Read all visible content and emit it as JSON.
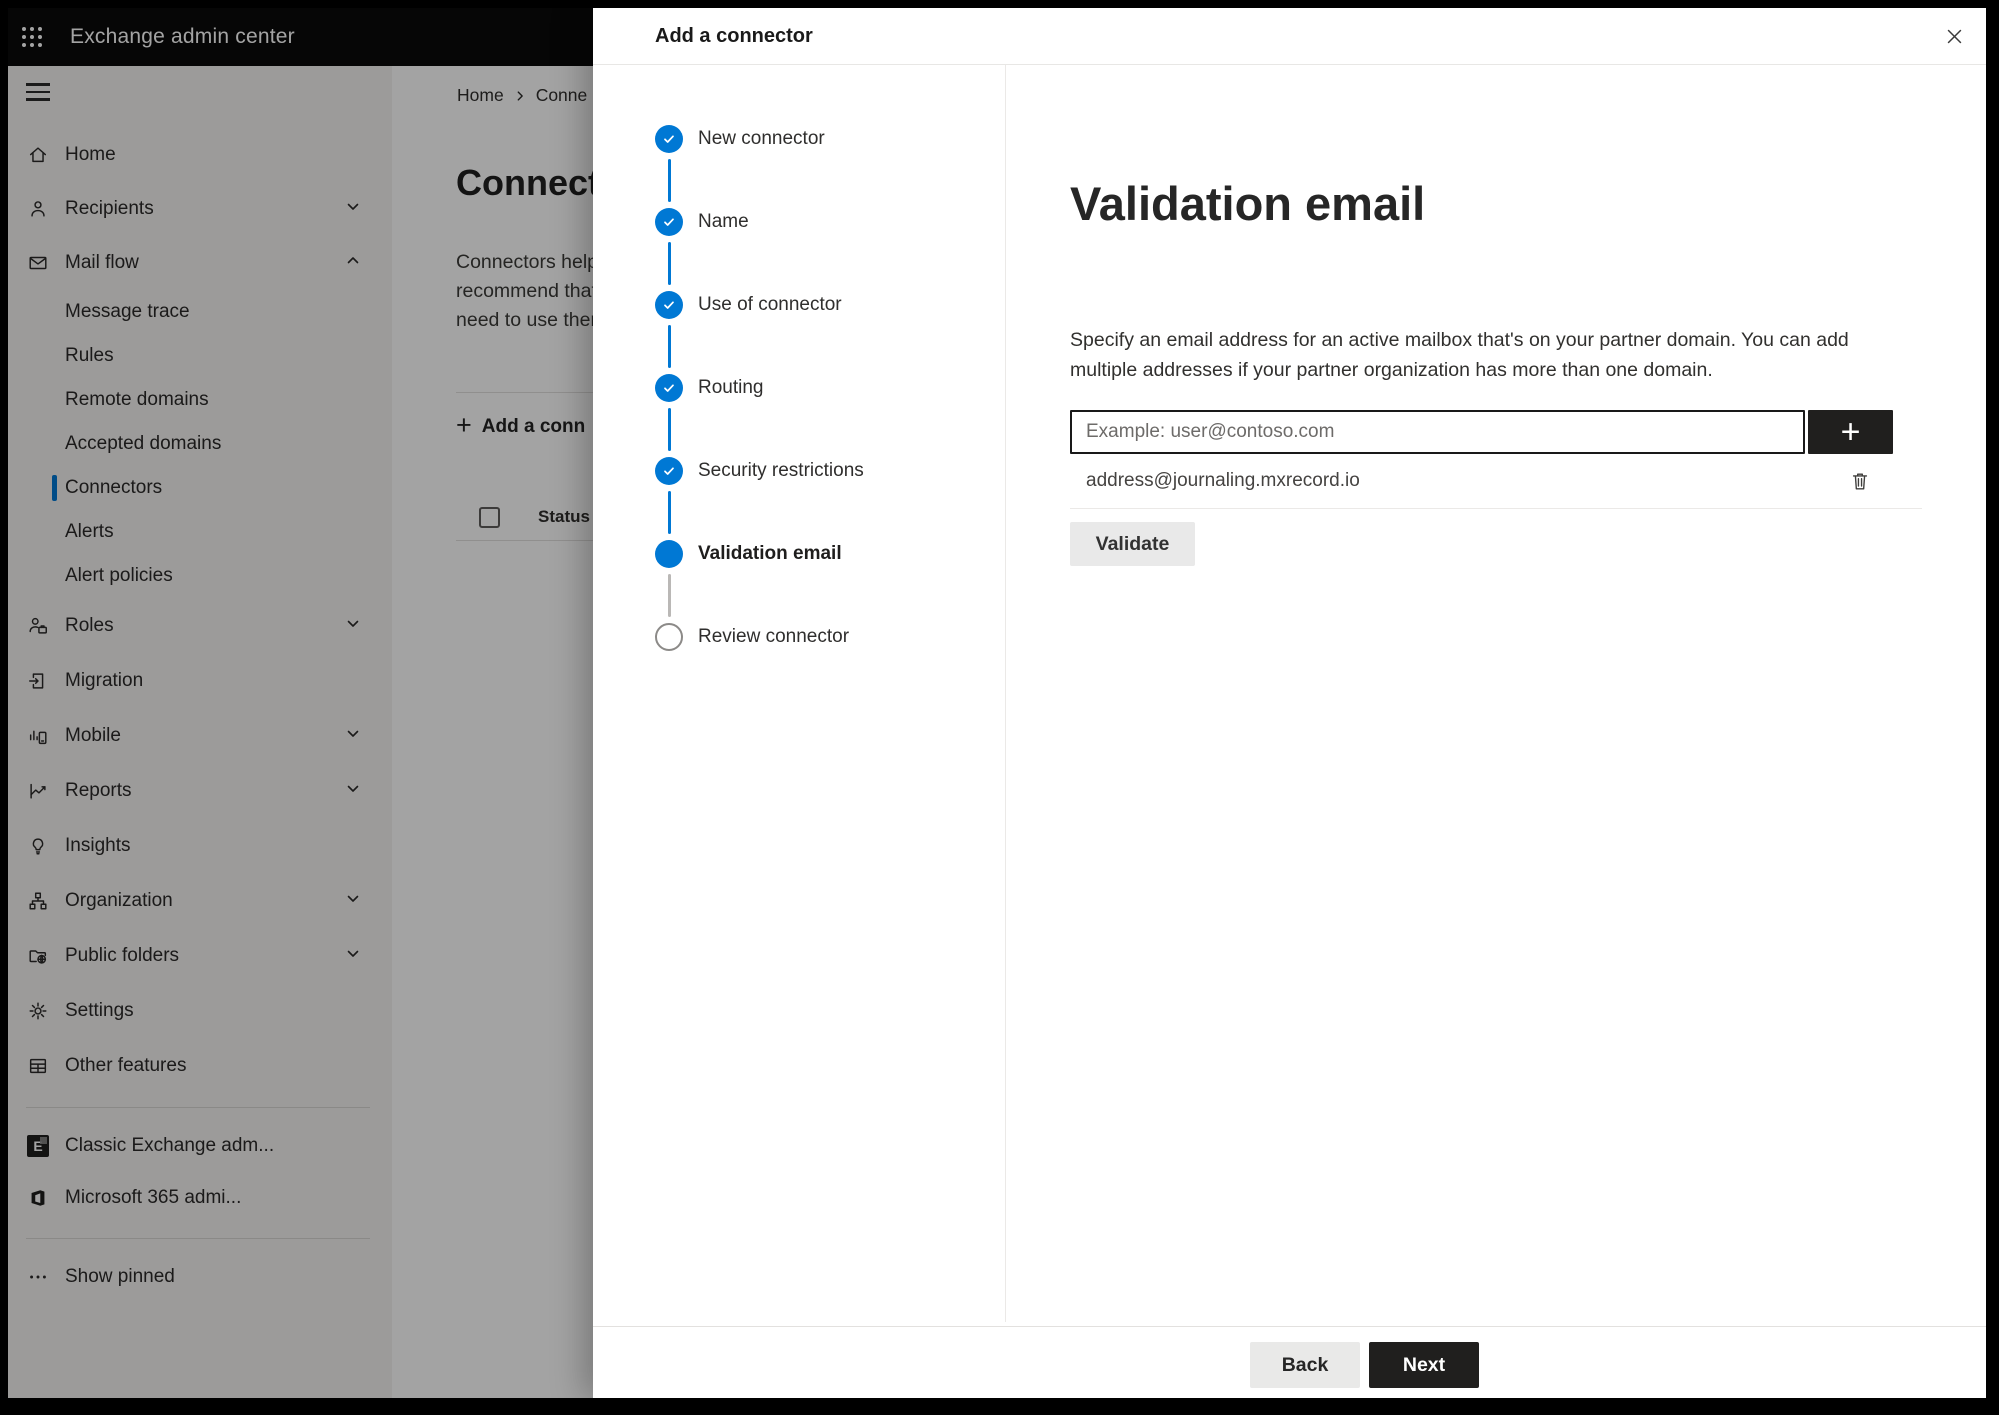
{
  "topbar": {
    "title": "Exchange admin center"
  },
  "sidebar": {
    "items": [
      {
        "label": "Home",
        "icon": "home-icon",
        "level": 1
      },
      {
        "label": "Recipients",
        "icon": "person-icon",
        "level": 1,
        "chevron": "down"
      },
      {
        "label": "Mail flow",
        "icon": "mail-icon",
        "level": 1,
        "chevron": "up",
        "expanded": true
      },
      {
        "label": "Message trace",
        "level": 2
      },
      {
        "label": "Rules",
        "level": 2
      },
      {
        "label": "Remote domains",
        "level": 2
      },
      {
        "label": "Accepted domains",
        "level": 2
      },
      {
        "label": "Connectors",
        "level": 2,
        "selected": true
      },
      {
        "label": "Alerts",
        "level": 2
      },
      {
        "label": "Alert policies",
        "level": 2
      },
      {
        "label": "Roles",
        "icon": "roles-icon",
        "level": 1,
        "chevron": "down"
      },
      {
        "label": "Migration",
        "icon": "migration-icon",
        "level": 1
      },
      {
        "label": "Mobile",
        "icon": "mobile-icon",
        "level": 1,
        "chevron": "down"
      },
      {
        "label": "Reports",
        "icon": "reports-icon",
        "level": 1,
        "chevron": "down"
      },
      {
        "label": "Insights",
        "icon": "lightbulb-icon",
        "level": 1
      },
      {
        "label": "Organization",
        "icon": "org-icon",
        "level": 1,
        "chevron": "down"
      },
      {
        "label": "Public folders",
        "icon": "folder-globe-icon",
        "level": 1,
        "chevron": "down"
      },
      {
        "label": "Settings",
        "icon": "gear-icon",
        "level": 1
      },
      {
        "label": "Other features",
        "icon": "grid-icon",
        "level": 1
      }
    ],
    "links": [
      {
        "label": "Classic Exchange adm...",
        "icon": "exchange-logo-icon"
      },
      {
        "label": "Microsoft 365 admi...",
        "icon": "office-logo-icon"
      }
    ],
    "show_pinned_label": "Show pinned"
  },
  "page": {
    "breadcrumb": {
      "home": "Home",
      "current": "Conne"
    },
    "title": "Connect",
    "intro_lines": {
      "0": "Connectors help",
      "1": "recommend that",
      "2": "need to use ther"
    },
    "add_button_label": "Add a conn",
    "status_header": "Status"
  },
  "modal": {
    "title": "Add a connector",
    "steps": [
      {
        "label": "New connector",
        "state": "completed"
      },
      {
        "label": "Name",
        "state": "completed"
      },
      {
        "label": "Use of connector",
        "state": "completed"
      },
      {
        "label": "Routing",
        "state": "completed"
      },
      {
        "label": "Security restrictions",
        "state": "completed"
      },
      {
        "label": "Validation email",
        "state": "active"
      },
      {
        "label": "Review connector",
        "state": "pending"
      }
    ],
    "content": {
      "heading": "Validation email",
      "description": "Specify an email address for an active mailbox that's on your partner domain. You can add multiple addresses if your partner organization has more than one domain.",
      "email_input": {
        "value": "",
        "placeholder": "Example: user@contoso.com"
      },
      "addresses": [
        "address@journaling.mxrecord.io"
      ],
      "validate_label": "Validate"
    },
    "footer": {
      "back_label": "Back",
      "next_label": "Next"
    }
  },
  "icons": {
    "plus": "+",
    "waffle-icon": "3x3 dot grid",
    "hamburger-icon": "three bars",
    "close-icon": "X",
    "check-icon": "checkmark",
    "trash-icon": "trash can",
    "chevron-right-icon": ">",
    "exchange-logo-letter": "E"
  },
  "colors": {
    "accent": "#0078d4",
    "topbar_bg": "#0a0a0a",
    "sidebar_bg": "#f4f3f1",
    "primary_button_bg": "#201f1e",
    "secondary_button_bg": "#e9e9e9",
    "pending_step_border": "#8c8a88",
    "overlay": "rgba(0,0,0,0.36)"
  }
}
